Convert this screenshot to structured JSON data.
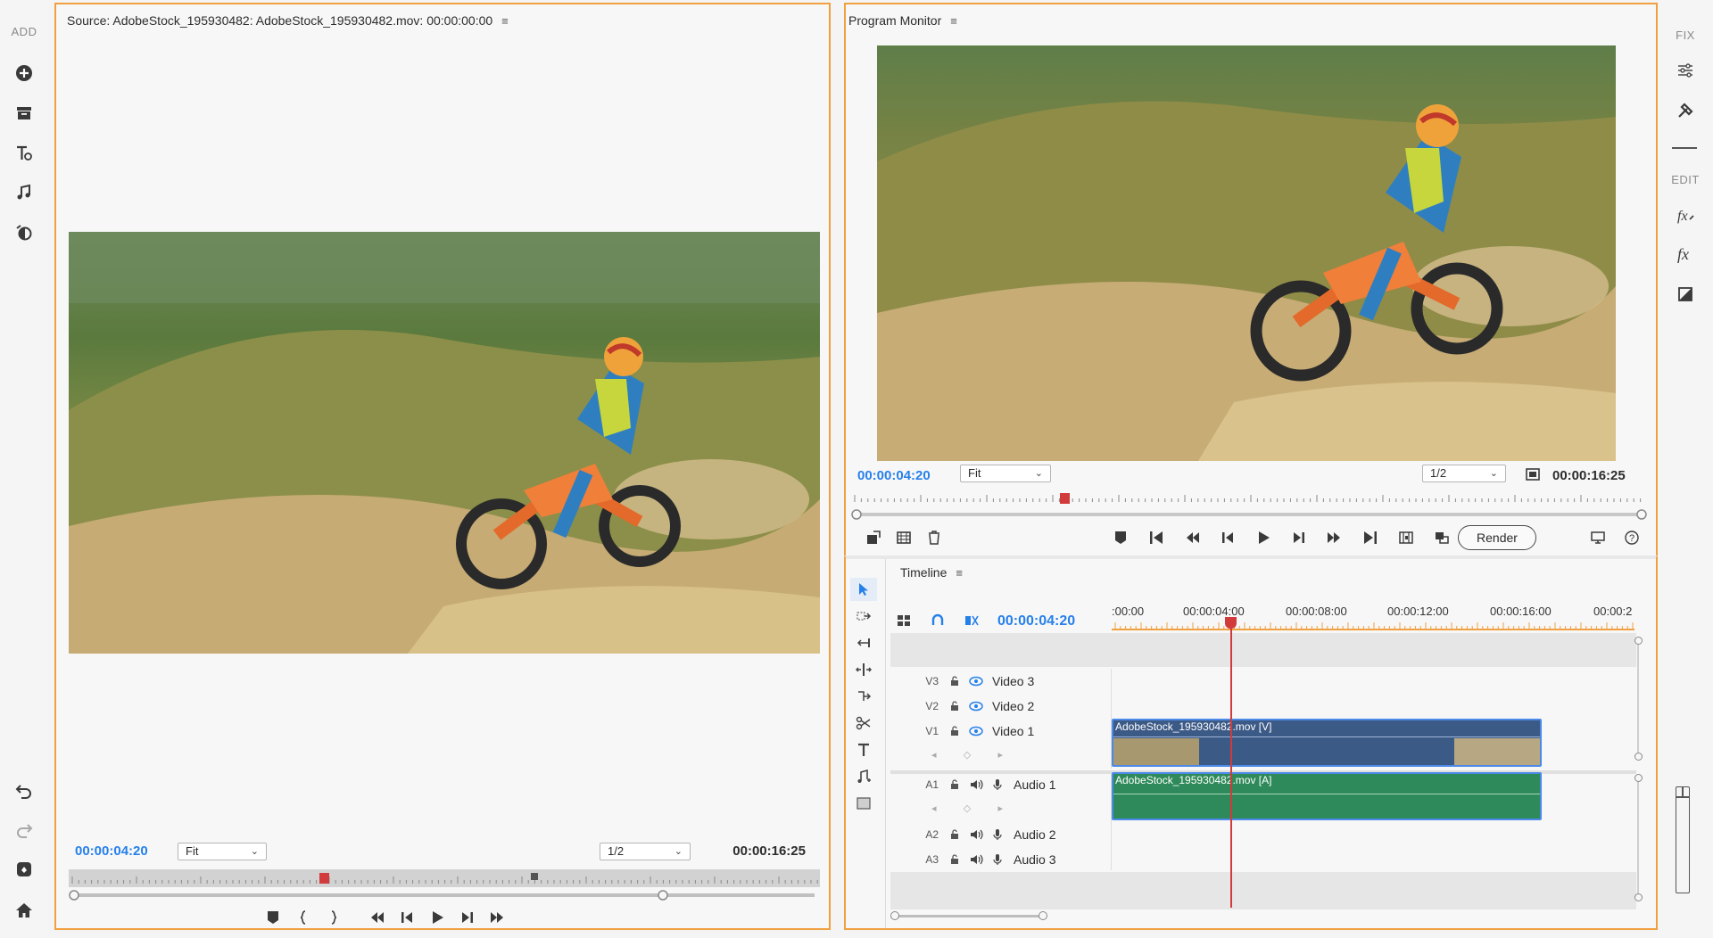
{
  "left_rail": {
    "add_label": "ADD",
    "items": [
      {
        "name": "add-media-icon"
      },
      {
        "name": "archive-icon"
      },
      {
        "name": "titles-icon"
      },
      {
        "name": "audio-icon"
      },
      {
        "name": "transitions-icon"
      }
    ],
    "bottom": [
      {
        "name": "undo-icon"
      },
      {
        "name": "redo-icon"
      },
      {
        "name": "tutorial-icon"
      },
      {
        "name": "home-icon"
      }
    ]
  },
  "right_rail": {
    "fix_label": "FIX",
    "edit_label": "EDIT"
  },
  "source": {
    "title": "Source: AdobeStock_195930482: AdobeStock_195930482.mov: 00:00:00:00",
    "timecode": "00:00:04:20",
    "zoom": "Fit",
    "resolution": "1/2",
    "duration": "00:00:16:25",
    "playhead_fraction": 0.34
  },
  "program": {
    "title": "Program Monitor",
    "timecode": "00:00:04:20",
    "zoom": "Fit",
    "resolution": "1/2",
    "duration": "00:00:16:25",
    "render_label": "Render",
    "playhead_fraction": 0.27
  },
  "timeline": {
    "title": "Timeline",
    "timecode": "00:00:04:20",
    "ruler": [
      ":00:00",
      "00:00:04:00",
      "00:00:08:00",
      "00:00:12:00",
      "00:00:16:00",
      "00:00:2"
    ],
    "video_tracks": [
      {
        "id": "V3",
        "name": "Video 3"
      },
      {
        "id": "V2",
        "name": "Video 2"
      },
      {
        "id": "V1",
        "name": "Video 1"
      }
    ],
    "audio_tracks": [
      {
        "id": "A1",
        "name": "Audio 1"
      },
      {
        "id": "A2",
        "name": "Audio 2"
      },
      {
        "id": "A3",
        "name": "Audio 3"
      }
    ],
    "video_clip": "AdobeStock_195930482.mov [V]",
    "audio_clip": "AdobeStock_195930482.mov [A]"
  },
  "colors": {
    "panel_border": "#f0a040",
    "timecode": "#2680eb",
    "playhead": "#d23b3b",
    "video_clip": "#3c5a86",
    "audio_clip": "#2e8a5a"
  }
}
